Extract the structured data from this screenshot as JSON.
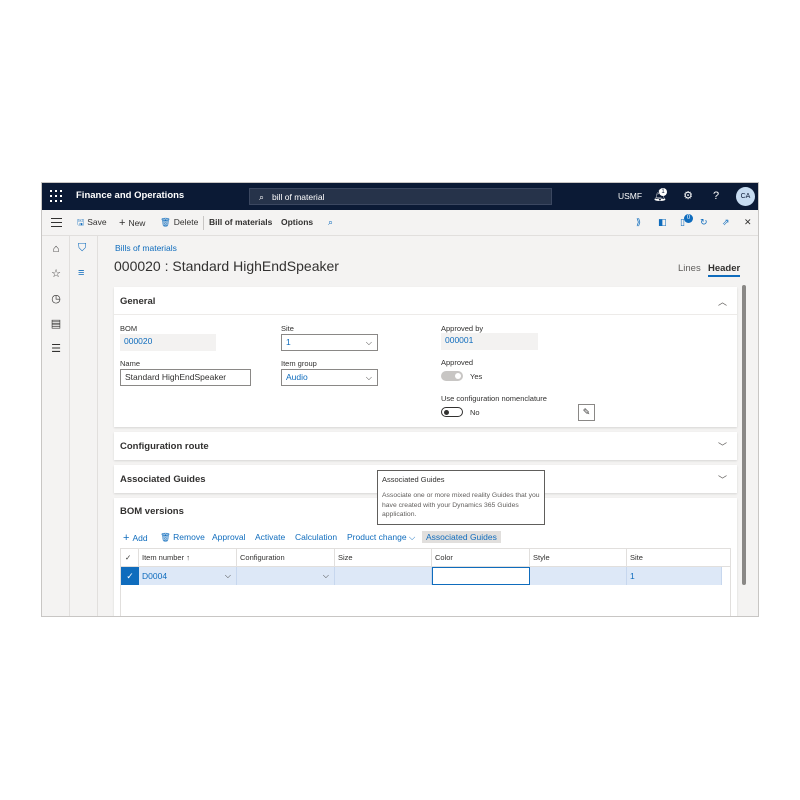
{
  "topbar": {
    "app_title": "Finance and Operations",
    "search_value": "bill of material",
    "company": "USMF",
    "notification_count": "1",
    "avatar_initials": "CA"
  },
  "actionbar": {
    "save": "Save",
    "new": "New",
    "delete": "Delete",
    "bill_of_materials": "Bill of materials",
    "options": "Options",
    "attachment_count": "0"
  },
  "page": {
    "breadcrumb": "Bills of materials",
    "title": "000020 : Standard HighEndSpeaker",
    "views": [
      "Lines",
      "Header"
    ],
    "active_view": "Header"
  },
  "general": {
    "header": "General",
    "bom_label": "BOM",
    "bom_value": "000020",
    "name_label": "Name",
    "name_value": "Standard HighEndSpeaker",
    "site_label": "Site",
    "site_value": "1",
    "item_group_label": "Item group",
    "item_group_value": "Audio",
    "approved_by_label": "Approved by",
    "approved_by_value": "000001",
    "approved_label": "Approved",
    "approved_value": "Yes",
    "use_config_label": "Use configuration nomenclature",
    "use_config_value": "No"
  },
  "sections": {
    "configuration_route": "Configuration route",
    "associated_guides": "Associated Guides",
    "bom_versions": "BOM versions"
  },
  "tooltip": {
    "title": "Associated Guides",
    "body": "Associate one or more mixed reality Guides that you have created with your Dynamics 365 Guides application."
  },
  "bom_versions": {
    "actions": {
      "add": "Add",
      "remove": "Remove",
      "approval": "Approval",
      "activate": "Activate",
      "calculation": "Calculation",
      "product_change": "Product change",
      "associated_guides": "Associated Guides"
    },
    "columns": [
      "Item number",
      "Configuration",
      "Size",
      "Color",
      "Style",
      "Site"
    ],
    "rows": [
      {
        "item_number": "D0004",
        "configuration": "",
        "size": "",
        "color": "",
        "style": "",
        "site": "1"
      }
    ]
  },
  "colors": {
    "topbar": "#0b1a35",
    "accent": "#0f6cbd",
    "selected_row": "#dde8f7"
  }
}
